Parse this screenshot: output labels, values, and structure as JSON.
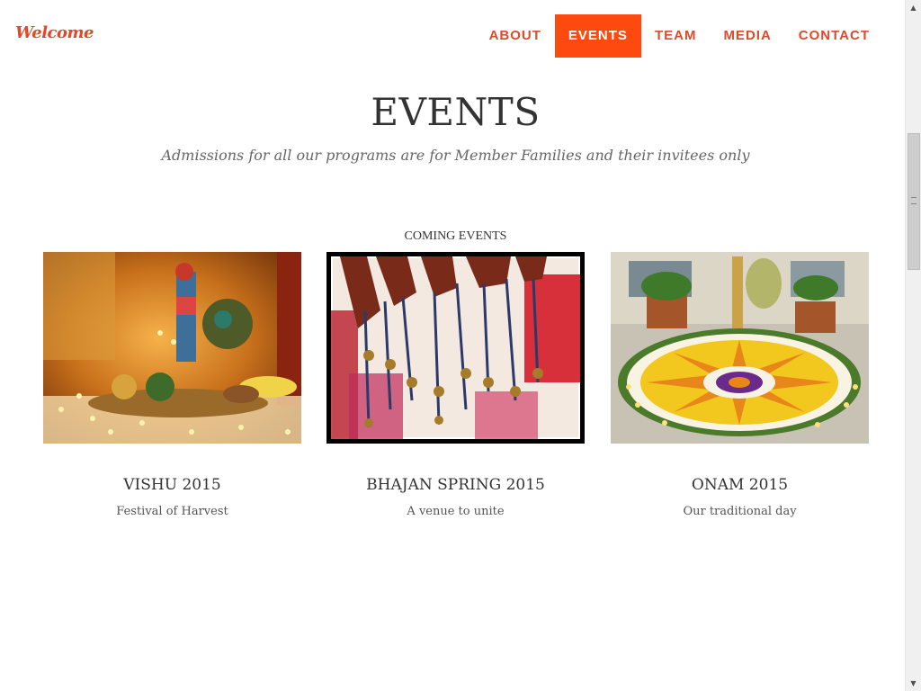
{
  "brand": "Welcome",
  "nav": {
    "items": [
      "ABOUT",
      "EVENTS",
      "TEAM",
      "MEDIA",
      "CONTACT"
    ],
    "active": "EVENTS"
  },
  "section": {
    "title": "EVENTS",
    "subtitle": "Admissions for all our programs are for Member Families and their invitees only",
    "coming_label": "COMING EVENTS"
  },
  "events": [
    {
      "title": "VISHU 2015",
      "desc": "Festival of Harvest",
      "image": "vishu-altar-photo"
    },
    {
      "title": "BHAJAN SPRING 2015",
      "desc": "A venue to unite",
      "image": "hanging-bells-photo"
    },
    {
      "title": "ONAM 2015",
      "desc": "Our traditional day",
      "image": "flower-rangoli-photo"
    }
  ],
  "colors": {
    "accent": "#fe4a0f",
    "brand": "#e0492a"
  },
  "scrollbar": {
    "up_icon": "arrow-up-icon",
    "down_icon": "arrow-down-icon"
  }
}
